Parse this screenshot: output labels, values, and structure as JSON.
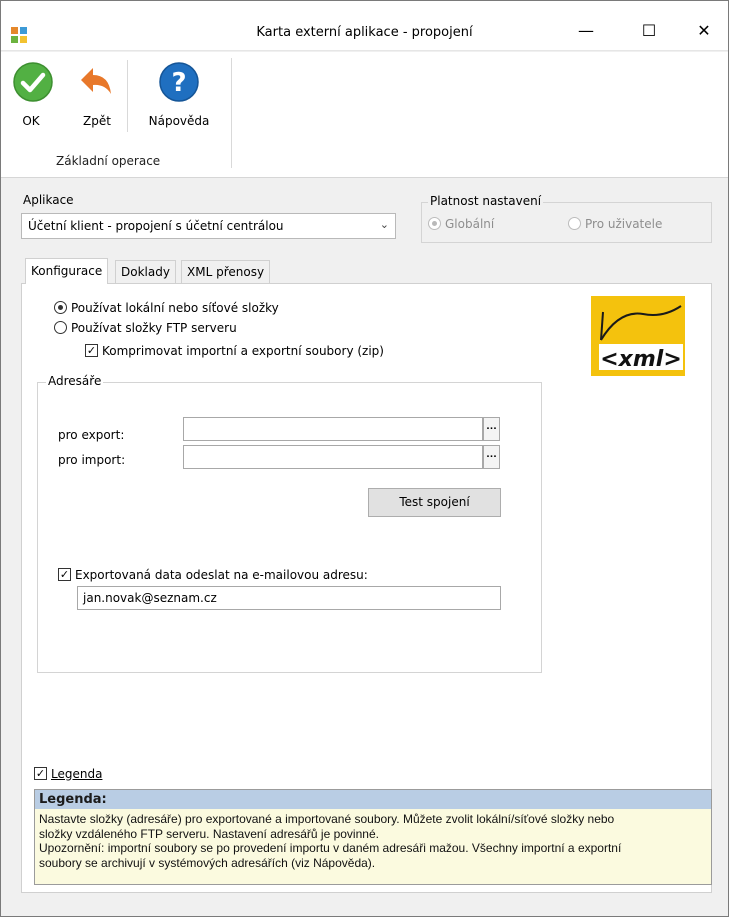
{
  "window": {
    "title": "Karta externí aplikace - propojení",
    "minimize_glyph": "—",
    "maximize_glyph": "☐",
    "close_glyph": "✕"
  },
  "ribbon": {
    "ok_label": "OK",
    "back_label": "Zpět",
    "help_label": "Nápověda",
    "group_label": "Základní operace",
    "colors": {
      "ok": "#4cae3a",
      "back": "#e37a2c",
      "help": "#1f70c1"
    }
  },
  "aplikace": {
    "label": "Aplikace",
    "selected": "Účetní klient - propojení s účetní centrálou"
  },
  "platnost": {
    "legend": "Platnost nastavení",
    "options": [
      {
        "label": "Globální",
        "checked": true,
        "enabled": false
      },
      {
        "label": "Pro uživatele",
        "checked": false,
        "enabled": false
      }
    ]
  },
  "tabs": [
    {
      "label": "Konfigurace",
      "active": true
    },
    {
      "label": "Doklady",
      "active": false
    },
    {
      "label": "XML přenosy",
      "active": false
    }
  ],
  "konfigurace": {
    "radio_local": "Používat lokální nebo síťové složky",
    "radio_ftp": "Používat složky FTP serveru",
    "local_checked": true,
    "compress_label": "Komprimovat importní a exportní soubory (zip)",
    "compress_checked": true,
    "xml_logo_text": "<xml>",
    "adresare": {
      "legend": "Adresáře",
      "export_label": "pro export:",
      "export_value": "",
      "import_label": "pro import:",
      "import_value": "",
      "browse_glyph": "…",
      "test_button": "Test spojení"
    },
    "email_label": "Exportovaná data odeslat na e-mailovou adresu:",
    "email_checked": true,
    "email_value": "jan.novak@seznam.cz"
  },
  "legenda": {
    "checkbox_label": "Legenda",
    "checked": true,
    "title": "Legenda:",
    "line1": "Nastavte složky (adresáře) pro exportované a importované soubory. Můžete zvolit lokální/síťové složky nebo",
    "line2": "složky vzdáleného FTP serveru. Nastavení adresářů je povinné.",
    "line3": "Upozornění: importní soubory se po provedení importu v daném adresáři mažou. Všechny importní a exportní",
    "line4": "soubory se archivují v systémových adresářích (viz Nápověda)."
  }
}
